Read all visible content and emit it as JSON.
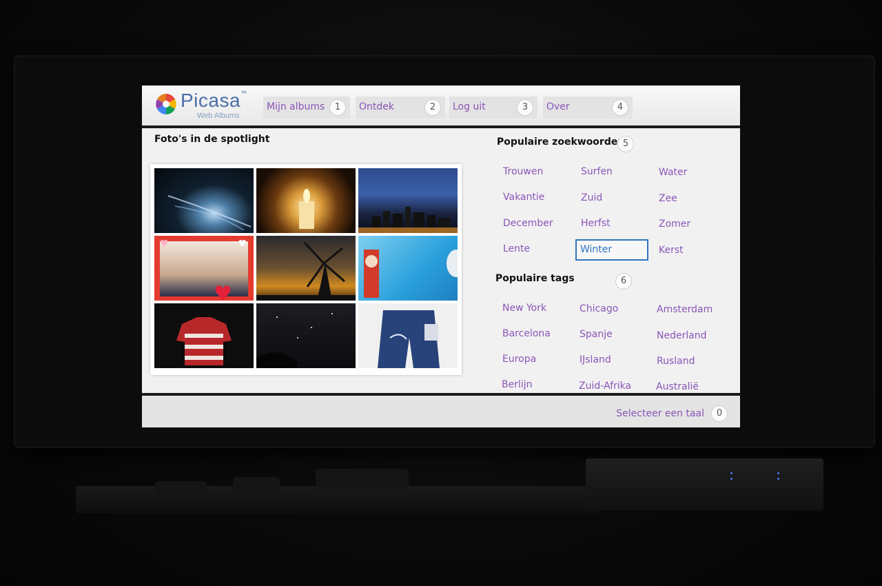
{
  "app": {
    "logo_text": "Picasa",
    "logo_tm": "™",
    "logo_sub": "Web Albums"
  },
  "nav": [
    {
      "label": "Mijn albums",
      "number": "1"
    },
    {
      "label": "Ontdek",
      "number": "2"
    },
    {
      "label": "Log uit",
      "number": "3"
    },
    {
      "label": "Over",
      "number": "4"
    }
  ],
  "spotlight": {
    "title": "Foto's in de spotlight"
  },
  "keywords": {
    "title": "Populaire zoekwoorden",
    "number": "5",
    "items": [
      "Trouwen",
      "Surfen",
      "Water",
      "Vakantie",
      "Zuid",
      "Zee",
      "December",
      "Herfst",
      "Zomer",
      "Lente",
      "Winter",
      "Kerst"
    ],
    "selected": "Winter"
  },
  "tags": {
    "title": "Populaire tags",
    "number": "6",
    "items": [
      "New York",
      "Chicago",
      "Amsterdam",
      "Barcelona",
      "Spanje",
      "Nederland",
      "Europa",
      "IJsland",
      "Rusland",
      "Berlijn",
      "Zuid-Afrika",
      "Australië"
    ]
  },
  "footer": {
    "language_label": "Selecteer een taal",
    "number": "0"
  },
  "colors": {
    "accent_purple": "#8a55b8",
    "selection_blue": "#2f74c0",
    "logo_blue": "#4a6fa8"
  }
}
